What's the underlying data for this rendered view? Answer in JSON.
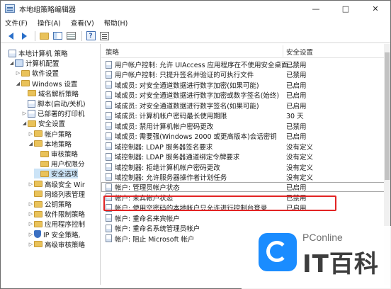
{
  "window": {
    "title": "本地组策略编辑器"
  },
  "menubar": {
    "items": [
      "文件(F)",
      "操作(A)",
      "查看(V)",
      "帮助(H)"
    ]
  },
  "tree": {
    "items": [
      {
        "label": "本地计算机 策略",
        "depth": 0,
        "icon": "policy-icon",
        "twisty": ""
      },
      {
        "label": "计算机配置",
        "depth": 1,
        "icon": "computer-icon",
        "twisty": "expanded"
      },
      {
        "label": "软件设置",
        "depth": 2,
        "icon": "folder-icon",
        "twisty": "collapsed"
      },
      {
        "label": "Windows 设置",
        "depth": 2,
        "icon": "folder-icon",
        "twisty": "expanded"
      },
      {
        "label": "域名解析策略",
        "depth": 3,
        "icon": "folder-icon",
        "twisty": ""
      },
      {
        "label": "脚本(启动/关机)",
        "depth": 3,
        "icon": "script-icon",
        "twisty": ""
      },
      {
        "label": "已部署的打印机",
        "depth": 3,
        "icon": "printer-icon",
        "twisty": "collapsed"
      },
      {
        "label": "安全设置",
        "depth": 3,
        "icon": "folder-icon",
        "twisty": "expanded"
      },
      {
        "label": "帐户策略",
        "depth": 4,
        "icon": "folder-icon",
        "twisty": "collapsed"
      },
      {
        "label": "本地策略",
        "depth": 4,
        "icon": "folder-icon",
        "twisty": "expanded"
      },
      {
        "label": "审核策略",
        "depth": 5,
        "icon": "folder-icon",
        "twisty": ""
      },
      {
        "label": "用户权限分",
        "depth": 5,
        "icon": "folder-icon",
        "twisty": ""
      },
      {
        "label": "安全选项",
        "depth": 5,
        "icon": "folder-icon",
        "twisty": "",
        "selected": true
      },
      {
        "label": "高级安全 Wir",
        "depth": 4,
        "icon": "folder-icon",
        "twisty": "collapsed"
      },
      {
        "label": "网络列表管理",
        "depth": 4,
        "icon": "folder-icon",
        "twisty": ""
      },
      {
        "label": "公钥策略",
        "depth": 4,
        "icon": "folder-icon",
        "twisty": "collapsed"
      },
      {
        "label": "软件限制策略",
        "depth": 4,
        "icon": "folder-icon",
        "twisty": "collapsed"
      },
      {
        "label": "应用程序控制",
        "depth": 4,
        "icon": "folder-icon",
        "twisty": "collapsed"
      },
      {
        "label": "IP 安全策略,",
        "depth": 4,
        "icon": "shield-icon",
        "twisty": "collapsed"
      },
      {
        "label": "高级审核策略",
        "depth": 4,
        "icon": "folder-icon",
        "twisty": "collapsed"
      }
    ]
  },
  "list": {
    "columns": {
      "policy": "策略",
      "setting": "安全设置"
    },
    "rows": [
      {
        "name": "用户帐户控制: 允许 UIAccess 应用程序在不使用安全桌面...",
        "value": "已禁用"
      },
      {
        "name": "用户帐户控制: 只提升签名并验证的可执行文件",
        "value": "已禁用"
      },
      {
        "name": "域成员: 对安全通道数据进行数字加密(如果可能)",
        "value": "已启用"
      },
      {
        "name": "域成员: 对安全通道数据进行数字加密或数字签名(始终)",
        "value": "已启用"
      },
      {
        "name": "域成员: 对安全通道数据进行数字签名(如果可能)",
        "value": "已启用"
      },
      {
        "name": "域成员: 计算机帐户密码最长使用期限",
        "value": "30 天"
      },
      {
        "name": "域成员: 禁用计算机帐户密码更改",
        "value": "已禁用"
      },
      {
        "name": "域成员: 需要强(Windows 2000 或更高版本)会话密钥",
        "value": "已启用"
      },
      {
        "name": "域控制器: LDAP 服务器签名要求",
        "value": "没有定义"
      },
      {
        "name": "域控制器: LDAP 服务器通道绑定令牌要求",
        "value": "没有定义"
      },
      {
        "name": "域控制器: 拒绝计算机帐户密码更改",
        "value": "没有定义"
      },
      {
        "name": "域控制器: 允许服务器操作者计划任务",
        "value": "没有定义"
      },
      {
        "name": "帐户: 管理员帐户状态",
        "value": "已启用",
        "selected": true
      },
      {
        "name": "帐户: 来宾帐户状态",
        "value": "已禁用"
      },
      {
        "name": "帐户: 使用空密码的本地帐户只允许进行控制台登录",
        "value": "已启用"
      },
      {
        "name": "帐户: 重命名来宾帐户",
        "value": ""
      },
      {
        "name": "帐户: 重命名系统管理员帐户",
        "value": ""
      },
      {
        "name": "帐户: 阻止 Microsoft 帐户",
        "value": ""
      }
    ]
  },
  "watermark": {
    "brand": "PConline",
    "big_text": "IT百科"
  }
}
